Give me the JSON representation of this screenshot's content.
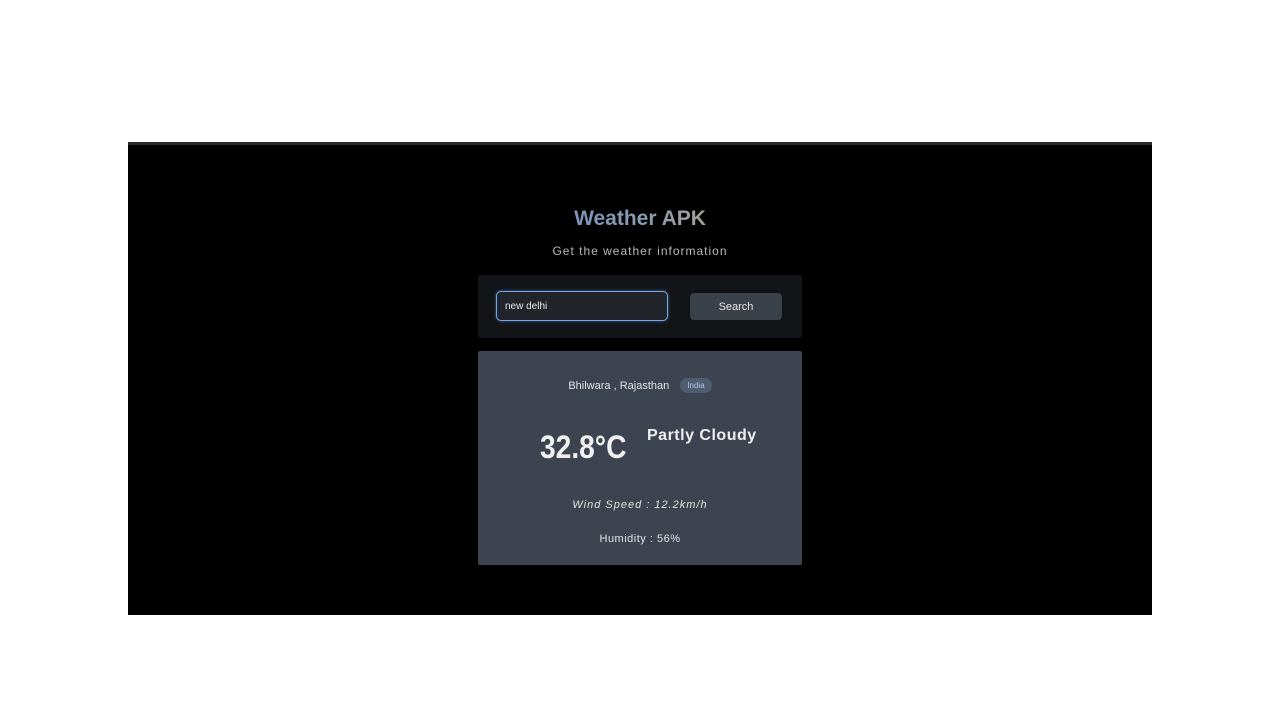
{
  "header": {
    "title": "Weather APK",
    "subtitle": "Get the weather information"
  },
  "search": {
    "value": "new delhi",
    "placeholder": "",
    "button_label": "Search"
  },
  "weather": {
    "location": "Bhilwara , Rajasthan",
    "country": "India",
    "temperature": "32.8°C",
    "condition": "Partly Cloudy",
    "wind": "Wind Speed : 12.2km/h",
    "humidity": "Humidity : 56%"
  },
  "colors": {
    "background": "#000000",
    "panel": "#121417",
    "card": "#3d4450",
    "input_focus": "#6fa7f0",
    "button": "#3b4148",
    "badge": "#4f5d73"
  }
}
